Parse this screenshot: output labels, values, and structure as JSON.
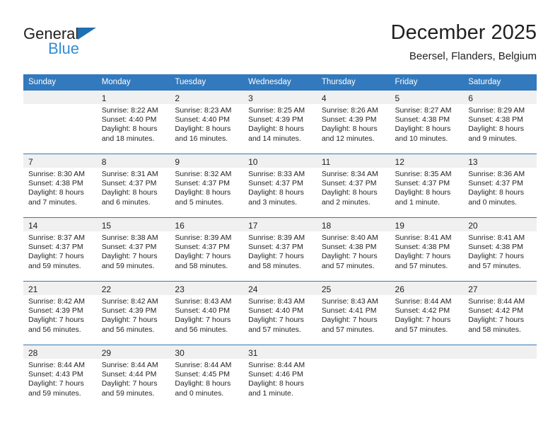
{
  "brand": {
    "name_top": "General",
    "name_bottom": "Blue",
    "accent_dark": "#1f6fb5",
    "accent_light": "#2f8ed6"
  },
  "header": {
    "title": "December 2025",
    "subtitle": "Beersel, Flanders, Belgium"
  },
  "theme": {
    "header_bg": "#3379bd",
    "header_text": "#ffffff",
    "daynum_bg": "#f0f0f0",
    "body_text": "#231f20"
  },
  "weekday_headers": [
    "Sunday",
    "Monday",
    "Tuesday",
    "Wednesday",
    "Thursday",
    "Friday",
    "Saturday"
  ],
  "weeks": [
    [
      {
        "day": "",
        "sunrise": "",
        "sunset": "",
        "daylight1": "",
        "daylight2": ""
      },
      {
        "day": "1",
        "sunrise": "Sunrise: 8:22 AM",
        "sunset": "Sunset: 4:40 PM",
        "daylight1": "Daylight: 8 hours",
        "daylight2": "and 18 minutes."
      },
      {
        "day": "2",
        "sunrise": "Sunrise: 8:23 AM",
        "sunset": "Sunset: 4:40 PM",
        "daylight1": "Daylight: 8 hours",
        "daylight2": "and 16 minutes."
      },
      {
        "day": "3",
        "sunrise": "Sunrise: 8:25 AM",
        "sunset": "Sunset: 4:39 PM",
        "daylight1": "Daylight: 8 hours",
        "daylight2": "and 14 minutes."
      },
      {
        "day": "4",
        "sunrise": "Sunrise: 8:26 AM",
        "sunset": "Sunset: 4:39 PM",
        "daylight1": "Daylight: 8 hours",
        "daylight2": "and 12 minutes."
      },
      {
        "day": "5",
        "sunrise": "Sunrise: 8:27 AM",
        "sunset": "Sunset: 4:38 PM",
        "daylight1": "Daylight: 8 hours",
        "daylight2": "and 10 minutes."
      },
      {
        "day": "6",
        "sunrise": "Sunrise: 8:29 AM",
        "sunset": "Sunset: 4:38 PM",
        "daylight1": "Daylight: 8 hours",
        "daylight2": "and 9 minutes."
      }
    ],
    [
      {
        "day": "7",
        "sunrise": "Sunrise: 8:30 AM",
        "sunset": "Sunset: 4:38 PM",
        "daylight1": "Daylight: 8 hours",
        "daylight2": "and 7 minutes."
      },
      {
        "day": "8",
        "sunrise": "Sunrise: 8:31 AM",
        "sunset": "Sunset: 4:37 PM",
        "daylight1": "Daylight: 8 hours",
        "daylight2": "and 6 minutes."
      },
      {
        "day": "9",
        "sunrise": "Sunrise: 8:32 AM",
        "sunset": "Sunset: 4:37 PM",
        "daylight1": "Daylight: 8 hours",
        "daylight2": "and 5 minutes."
      },
      {
        "day": "10",
        "sunrise": "Sunrise: 8:33 AM",
        "sunset": "Sunset: 4:37 PM",
        "daylight1": "Daylight: 8 hours",
        "daylight2": "and 3 minutes."
      },
      {
        "day": "11",
        "sunrise": "Sunrise: 8:34 AM",
        "sunset": "Sunset: 4:37 PM",
        "daylight1": "Daylight: 8 hours",
        "daylight2": "and 2 minutes."
      },
      {
        "day": "12",
        "sunrise": "Sunrise: 8:35 AM",
        "sunset": "Sunset: 4:37 PM",
        "daylight1": "Daylight: 8 hours",
        "daylight2": "and 1 minute."
      },
      {
        "day": "13",
        "sunrise": "Sunrise: 8:36 AM",
        "sunset": "Sunset: 4:37 PM",
        "daylight1": "Daylight: 8 hours",
        "daylight2": "and 0 minutes."
      }
    ],
    [
      {
        "day": "14",
        "sunrise": "Sunrise: 8:37 AM",
        "sunset": "Sunset: 4:37 PM",
        "daylight1": "Daylight: 7 hours",
        "daylight2": "and 59 minutes."
      },
      {
        "day": "15",
        "sunrise": "Sunrise: 8:38 AM",
        "sunset": "Sunset: 4:37 PM",
        "daylight1": "Daylight: 7 hours",
        "daylight2": "and 59 minutes."
      },
      {
        "day": "16",
        "sunrise": "Sunrise: 8:39 AM",
        "sunset": "Sunset: 4:37 PM",
        "daylight1": "Daylight: 7 hours",
        "daylight2": "and 58 minutes."
      },
      {
        "day": "17",
        "sunrise": "Sunrise: 8:39 AM",
        "sunset": "Sunset: 4:37 PM",
        "daylight1": "Daylight: 7 hours",
        "daylight2": "and 58 minutes."
      },
      {
        "day": "18",
        "sunrise": "Sunrise: 8:40 AM",
        "sunset": "Sunset: 4:38 PM",
        "daylight1": "Daylight: 7 hours",
        "daylight2": "and 57 minutes."
      },
      {
        "day": "19",
        "sunrise": "Sunrise: 8:41 AM",
        "sunset": "Sunset: 4:38 PM",
        "daylight1": "Daylight: 7 hours",
        "daylight2": "and 57 minutes."
      },
      {
        "day": "20",
        "sunrise": "Sunrise: 8:41 AM",
        "sunset": "Sunset: 4:38 PM",
        "daylight1": "Daylight: 7 hours",
        "daylight2": "and 57 minutes."
      }
    ],
    [
      {
        "day": "21",
        "sunrise": "Sunrise: 8:42 AM",
        "sunset": "Sunset: 4:39 PM",
        "daylight1": "Daylight: 7 hours",
        "daylight2": "and 56 minutes."
      },
      {
        "day": "22",
        "sunrise": "Sunrise: 8:42 AM",
        "sunset": "Sunset: 4:39 PM",
        "daylight1": "Daylight: 7 hours",
        "daylight2": "and 56 minutes."
      },
      {
        "day": "23",
        "sunrise": "Sunrise: 8:43 AM",
        "sunset": "Sunset: 4:40 PM",
        "daylight1": "Daylight: 7 hours",
        "daylight2": "and 56 minutes."
      },
      {
        "day": "24",
        "sunrise": "Sunrise: 8:43 AM",
        "sunset": "Sunset: 4:40 PM",
        "daylight1": "Daylight: 7 hours",
        "daylight2": "and 57 minutes."
      },
      {
        "day": "25",
        "sunrise": "Sunrise: 8:43 AM",
        "sunset": "Sunset: 4:41 PM",
        "daylight1": "Daylight: 7 hours",
        "daylight2": "and 57 minutes."
      },
      {
        "day": "26",
        "sunrise": "Sunrise: 8:44 AM",
        "sunset": "Sunset: 4:42 PM",
        "daylight1": "Daylight: 7 hours",
        "daylight2": "and 57 minutes."
      },
      {
        "day": "27",
        "sunrise": "Sunrise: 8:44 AM",
        "sunset": "Sunset: 4:42 PM",
        "daylight1": "Daylight: 7 hours",
        "daylight2": "and 58 minutes."
      }
    ],
    [
      {
        "day": "28",
        "sunrise": "Sunrise: 8:44 AM",
        "sunset": "Sunset: 4:43 PM",
        "daylight1": "Daylight: 7 hours",
        "daylight2": "and 59 minutes."
      },
      {
        "day": "29",
        "sunrise": "Sunrise: 8:44 AM",
        "sunset": "Sunset: 4:44 PM",
        "daylight1": "Daylight: 7 hours",
        "daylight2": "and 59 minutes."
      },
      {
        "day": "30",
        "sunrise": "Sunrise: 8:44 AM",
        "sunset": "Sunset: 4:45 PM",
        "daylight1": "Daylight: 8 hours",
        "daylight2": "and 0 minutes."
      },
      {
        "day": "31",
        "sunrise": "Sunrise: 8:44 AM",
        "sunset": "Sunset: 4:46 PM",
        "daylight1": "Daylight: 8 hours",
        "daylight2": "and 1 minute."
      },
      {
        "day": "",
        "sunrise": "",
        "sunset": "",
        "daylight1": "",
        "daylight2": ""
      },
      {
        "day": "",
        "sunrise": "",
        "sunset": "",
        "daylight1": "",
        "daylight2": ""
      },
      {
        "day": "",
        "sunrise": "",
        "sunset": "",
        "daylight1": "",
        "daylight2": ""
      }
    ]
  ]
}
